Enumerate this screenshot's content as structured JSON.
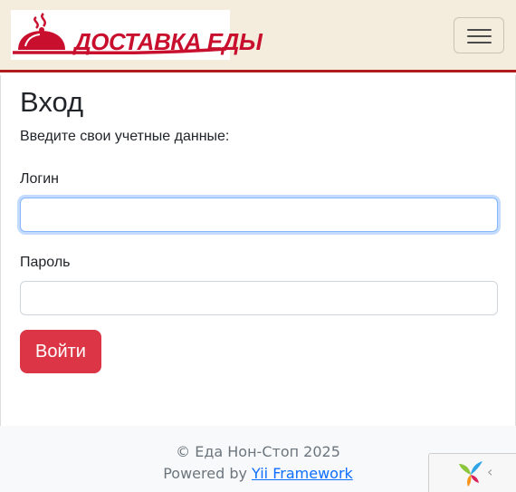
{
  "navbar": {
    "logo_text": "ДОСТАВКА ЕДЫ",
    "brand_color": "#c8102e",
    "background_color": "#f4ecdc",
    "toggler_icon": "hamburger-icon"
  },
  "login": {
    "title": "Вход",
    "subtitle": "Введите свои учетные данные:",
    "username_label": "Логин",
    "username_value": "",
    "password_label": "Пароль",
    "password_value": "",
    "submit_label": "Войти",
    "submit_color": "#dc3545"
  },
  "footer": {
    "copyright": "© Еда Нон-Стоп 2025",
    "powered_prefix": "Powered by ",
    "powered_link": "Yii Framework"
  },
  "debug_toolbar": {
    "logo_icon": "yii-logo-icon",
    "toggle_icon": "chevron-left-icon",
    "toggle_glyph": "‹"
  }
}
